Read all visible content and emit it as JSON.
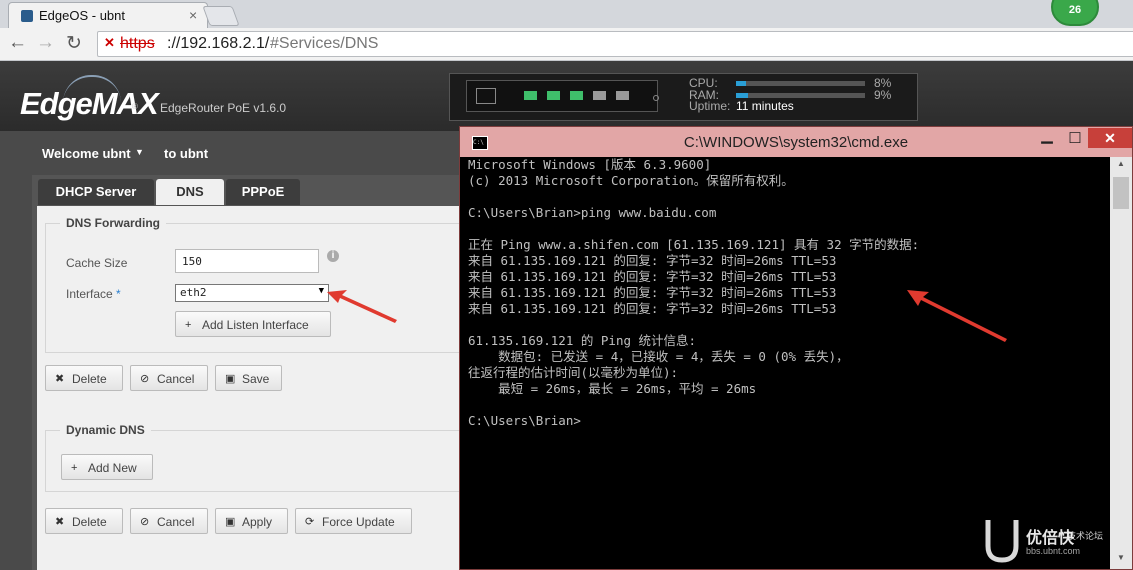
{
  "browser": {
    "tab_title": "EdgeOS - ubnt",
    "tab_close": "×",
    "badge_count": "26",
    "url_scheme": "https",
    "url_host": "://192.168.2.1/",
    "url_path": "#Services/DNS"
  },
  "header": {
    "logo": "EdgeMAX",
    "logo_reg": "®",
    "model": "EdgeRouter PoE v1.6.0",
    "cpu_label": "CPU:",
    "cpu_value": "8%",
    "cpu_fraction": 0.08,
    "ram_label": "RAM:",
    "ram_value": "9%",
    "ram_fraction": 0.09,
    "uptime_label": "Uptime:",
    "uptime_value": "11 minutes"
  },
  "user": {
    "welcome": "Welcome ubnt",
    "to": "to ubnt"
  },
  "tabs": {
    "dhcp": "DHCP Server",
    "dns": "DNS",
    "pppoe": "PPPoE"
  },
  "dns_forwarding": {
    "legend": "DNS Forwarding",
    "cache_label": "Cache Size",
    "cache_value": "150",
    "interface_label": "Interface",
    "interface_required": "*",
    "interface_value": "eth2",
    "add_listen": "Add Listen Interface"
  },
  "actions1": {
    "delete": "Delete",
    "cancel": "Cancel",
    "save": "Save"
  },
  "dynamic_dns": {
    "legend": "Dynamic DNS",
    "add_new": "Add New"
  },
  "actions2": {
    "delete": "Delete",
    "cancel": "Cancel",
    "apply": "Apply",
    "force_update": "Force Update"
  },
  "cmd": {
    "title": "C:\\WINDOWS\\system32\\cmd.exe",
    "lines": [
      "Microsoft Windows [版本 6.3.9600]",
      "(c) 2013 Microsoft Corporation。保留所有权利。",
      "",
      "C:\\Users\\Brian>ping www.baidu.com",
      "",
      "正在 Ping www.a.shifen.com [61.135.169.121] 具有 32 字节的数据:",
      "来自 61.135.169.121 的回复: 字节=32 时间=26ms TTL=53",
      "来自 61.135.169.121 的回复: 字节=32 时间=26ms TTL=53",
      "来自 61.135.169.121 的回复: 字节=32 时间=26ms TTL=53",
      "来自 61.135.169.121 的回复: 字节=32 时间=26ms TTL=53",
      "",
      "61.135.169.121 的 Ping 统计信息:",
      "    数据包: 已发送 = 4，已接收 = 4，丢失 = 0 (0% 丢失)，",
      "往返行程的估计时间(以毫秒为单位):",
      "    最短 = 26ms，最长 = 26ms，平均 = 26ms",
      "",
      "C:\\Users\\Brian>"
    ]
  },
  "watermark": {
    "brand": "优倍快",
    "sub": "技术论坛",
    "url": "bbs.ubnt.com"
  },
  "colors": {
    "accent": "#2a9fd6",
    "port_active": "#3fbf6b",
    "port_idle": "#9a9a9a",
    "annotation": "#e03a2f"
  }
}
